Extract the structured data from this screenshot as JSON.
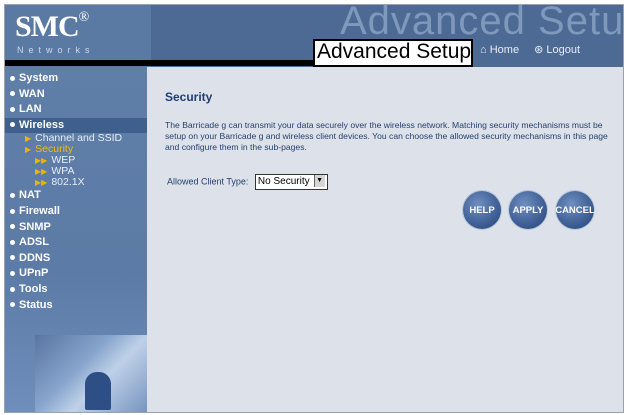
{
  "header": {
    "logo": "SMC",
    "logo_mark": "®",
    "logo_sub": "Networks",
    "watermark": "Advanced Setup",
    "title": "Advanced Setup",
    "home": "Home",
    "logout": "Logout",
    "home_icon": "home-icon",
    "logout_icon": "logout-icon"
  },
  "sidebar": {
    "items": [
      {
        "label": "System"
      },
      {
        "label": "WAN"
      },
      {
        "label": "LAN"
      },
      {
        "label": "Wireless"
      },
      {
        "label": "NAT"
      },
      {
        "label": "Firewall"
      },
      {
        "label": "SNMP"
      },
      {
        "label": "ADSL"
      },
      {
        "label": "DDNS"
      },
      {
        "label": "UPnP"
      },
      {
        "label": "Tools"
      },
      {
        "label": "Status"
      }
    ],
    "wireless_sub": [
      {
        "label": "Channel and SSID"
      },
      {
        "label": "Security"
      }
    ],
    "security_sub": [
      {
        "label": "WEP"
      },
      {
        "label": "WPA"
      },
      {
        "label": "802.1X"
      }
    ]
  },
  "main": {
    "title": "Security",
    "description": "The Barricade g can transmit your data securely over the wireless network. Matching security mechanisms must be setup on your Barricade g and wireless client devices. You can choose the allowed security mechanisms in this page and configure them in the sub-pages.",
    "client_type_label": "Allowed Client Type:",
    "client_type_value": "No Security",
    "buttons": {
      "help": "HELP",
      "apply": "APPLY",
      "cancel": "CANCEL"
    }
  }
}
